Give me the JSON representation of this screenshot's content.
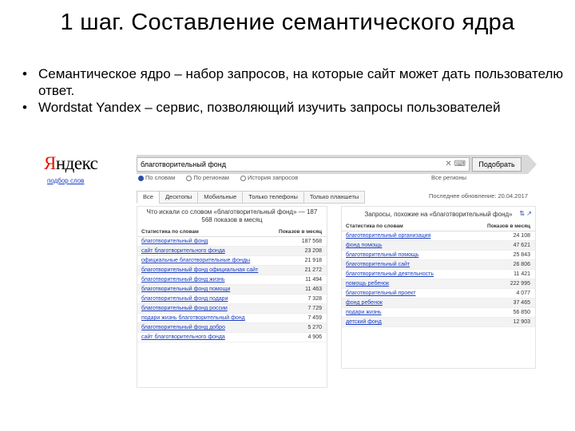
{
  "slide": {
    "title": "1 шаг. Составление семантического ядра",
    "bullets": [
      "Семантическое ядро – набор запросов, на которые сайт может дать пользователю ответ.",
      "Wordstat Yandex – сервис, позволяющий изучить запросы пользователей"
    ],
    "bullet_glyph": "•"
  },
  "wordstat": {
    "logo_first": "Я",
    "logo_rest": "ндекс",
    "logo_sub": "подбор слов",
    "search_value": "благотворительный фонд",
    "search_button": "Подобрать",
    "radios": [
      "По словам",
      "По регионам",
      "История запросов"
    ],
    "all_time": "Все регионы",
    "tabs": [
      "Все",
      "Десктопы",
      "Мобильные",
      "Только телефоны",
      "Только планшеты"
    ],
    "updated": "Последнее обновление: 20.04.2017",
    "left_title": "Что искали со словом «благотворительный фонд» — 187 568 показов в месяц",
    "left_col_query": "Статистика по словам",
    "left_col_count": "Показов в месяц",
    "left_rows": [
      {
        "q": "благотворительный фонд",
        "n": "187 568"
      },
      {
        "q": "сайт благотворительного фонда",
        "n": "23 208"
      },
      {
        "q": "официальные благотворительные фонды",
        "n": "21 918"
      },
      {
        "q": "благотворительный фонд официальная сайт",
        "n": "21 272"
      },
      {
        "q": "благотворительный фонд жизнь",
        "n": "11 494"
      },
      {
        "q": "благотворительный фонд помощи",
        "n": "11 463"
      },
      {
        "q": "благотворительный фонд подари",
        "n": "7 328"
      },
      {
        "q": "благотворительный фонд россии",
        "n": "7 729"
      },
      {
        "q": "подари жизнь благотворительный фонд",
        "n": "7 459"
      },
      {
        "q": "благотворительный фонд добро",
        "n": "5 270"
      },
      {
        "q": "сайт благотворительного фонда",
        "n": "4 906"
      }
    ],
    "right_title": "Запросы, похожие на «благотворительный фонд»",
    "right_col_query": "Статистика по словам",
    "right_col_count": "Показов в месяц",
    "right_rows": [
      {
        "q": "благотворительный организация",
        "n": "24 108"
      },
      {
        "q": "фонд помощь",
        "n": "47 621"
      },
      {
        "q": "благотворительный помощь",
        "n": "25 843"
      },
      {
        "q": "благотворительный сайт",
        "n": "26 806"
      },
      {
        "q": "благотворительный деятельность",
        "n": "11 421"
      },
      {
        "q": "помощь ребенок",
        "n": "222 995"
      },
      {
        "q": "благотворительный проект",
        "n": "4 077"
      },
      {
        "q": "фонд ребенок",
        "n": "37 465"
      },
      {
        "q": "подари жизнь",
        "n": "56 850"
      },
      {
        "q": "детский фонд",
        "n": "12 903"
      }
    ],
    "accent_color": "#e61400",
    "link_color": "#1a3dc1"
  }
}
